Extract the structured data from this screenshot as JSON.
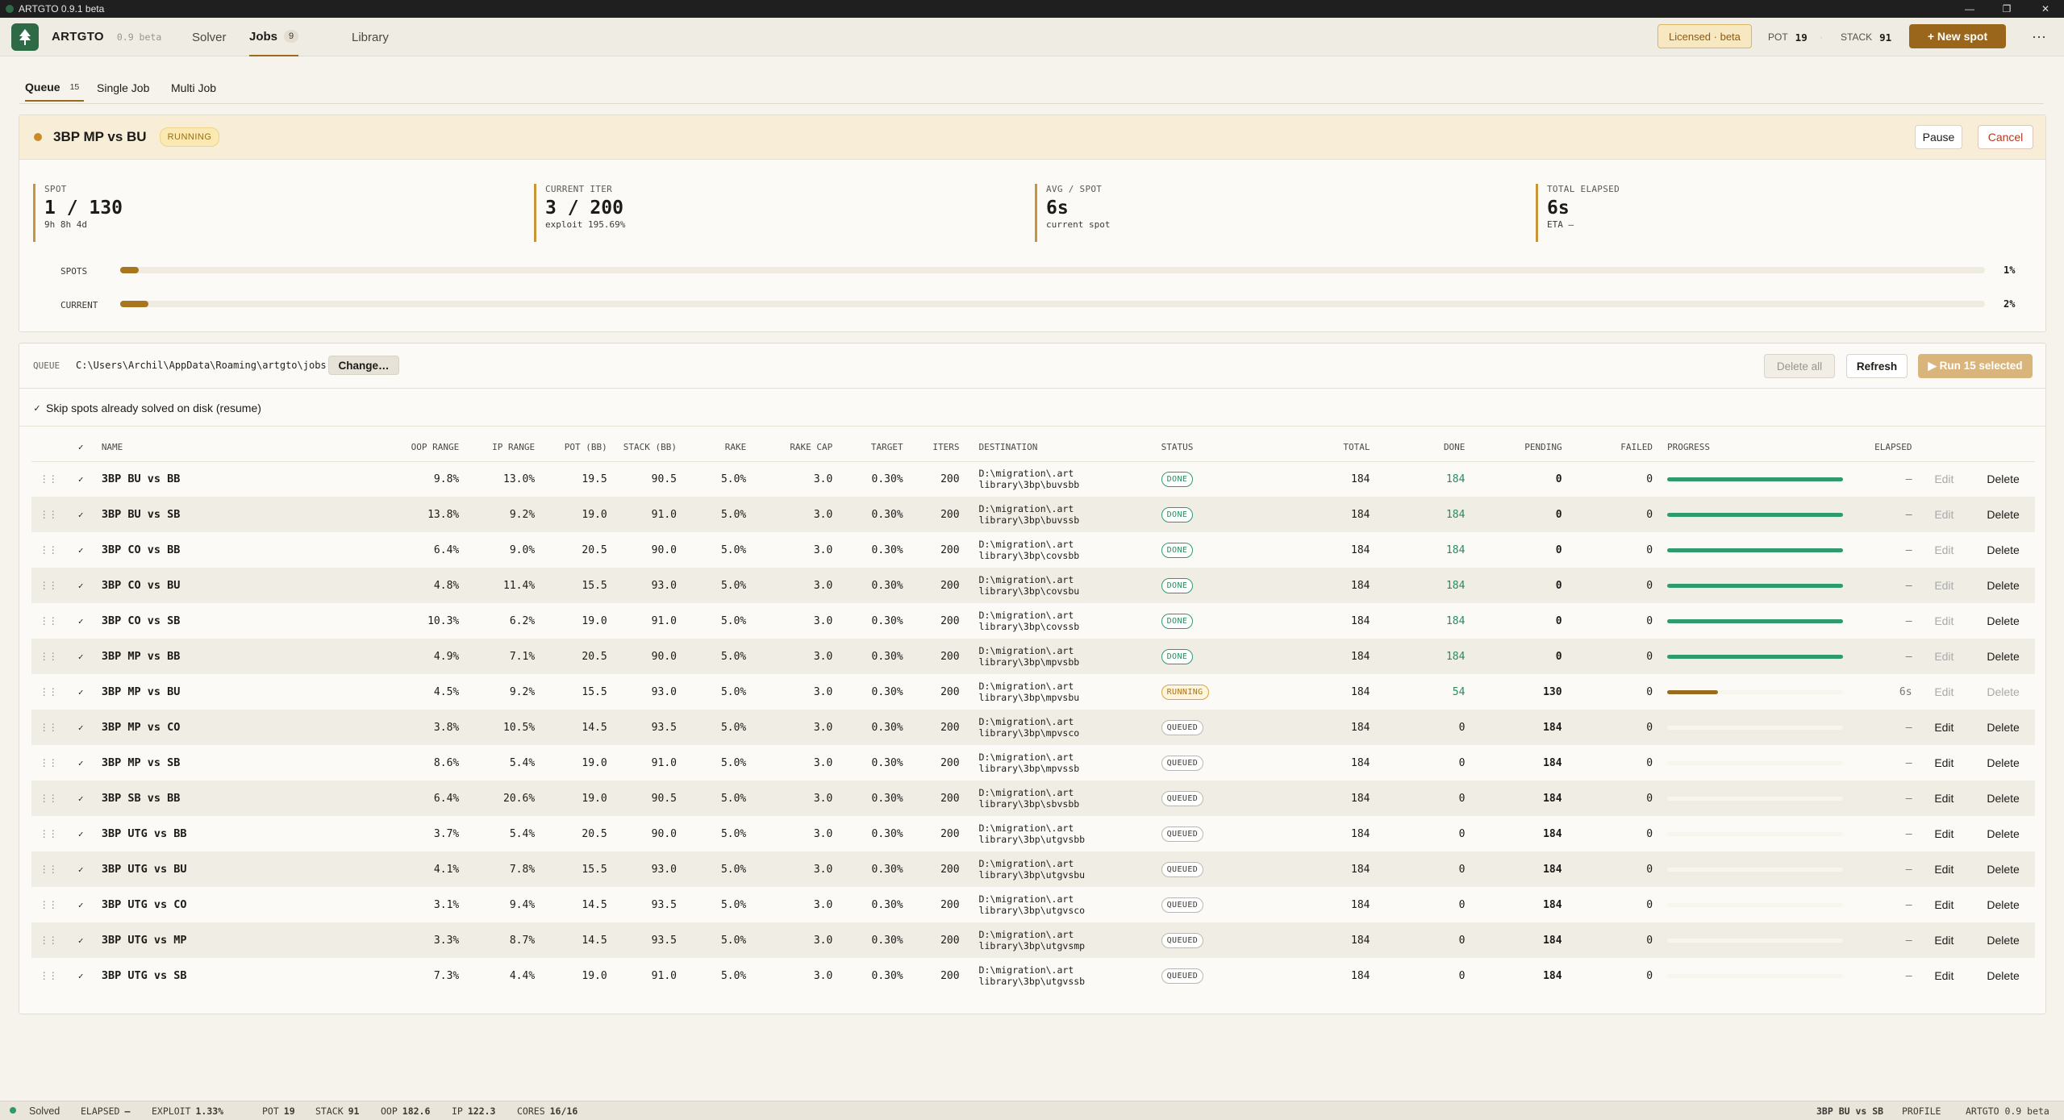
{
  "window": {
    "title": "ARTGTO 0.9.1 beta"
  },
  "header": {
    "brand": "ARTGTO",
    "version": "0.9 beta",
    "tabs": [
      {
        "label": "Solver"
      },
      {
        "label": "Jobs",
        "count": "9"
      },
      {
        "label": "Library"
      }
    ],
    "license": "Licensed · beta",
    "pot_label": "POT",
    "pot": "19",
    "stack_label": "STACK",
    "stack": "91",
    "new_spot": "+ New spot",
    "more": "···"
  },
  "subtabs": [
    {
      "label": "Queue",
      "count": "15"
    },
    {
      "label": "Single Job"
    },
    {
      "label": "Multi Job"
    }
  ],
  "running": {
    "name": "3BP MP vs BU",
    "status": "RUNNING",
    "pause": "Pause",
    "cancel": "Cancel",
    "metrics": [
      {
        "label": "SPOT",
        "value": "1 / 130",
        "sub": "9h 8h 4d"
      },
      {
        "label": "CURRENT ITER",
        "value": "3 / 200",
        "sub": "exploit 195.69%"
      },
      {
        "label": "AVG / SPOT",
        "value": "6s",
        "sub": "current spot"
      },
      {
        "label": "TOTAL ELAPSED",
        "value": "6s",
        "sub": "ETA —"
      }
    ],
    "progress": [
      {
        "label": "SPOTS",
        "pct": "1%",
        "value": 0.01
      },
      {
        "label": "CURRENT",
        "pct": "2%",
        "value": 0.015
      }
    ]
  },
  "queue": {
    "label": "QUEUE",
    "path": "C:\\Users\\Archil\\AppData\\Roaming\\artgto\\jobs",
    "change": "Change…",
    "delete_all": "Delete all",
    "refresh": "Refresh",
    "run": "▶ Run 15 selected",
    "skip": "Skip spots already solved on disk (resume)",
    "columns": [
      "NAME",
      "OOP RANGE",
      "IP RANGE",
      "POT (BB)",
      "STACK (BB)",
      "RAKE",
      "RAKE CAP",
      "TARGET",
      "ITERS",
      "DESTINATION",
      "STATUS",
      "TOTAL",
      "DONE",
      "PENDING",
      "FAILED",
      "PROGRESS",
      "ELAPSED"
    ],
    "rows": [
      {
        "name": "3BP BU vs BB",
        "oop": "9.8%",
        "ip": "13.0%",
        "pot": "19.5",
        "stack": "90.5",
        "rake": "5.0%",
        "cap": "3.0",
        "target": "0.30%",
        "iters": "200",
        "dest1": "D:\\migration\\.art",
        "dest2": "library\\3bp\\buvsbb",
        "status": "DONE",
        "total": "184",
        "done": "184",
        "pending": "0",
        "failed": "0",
        "progress": 1.0,
        "elapsed": "–",
        "edit": "Edit",
        "del": "Delete"
      },
      {
        "name": "3BP BU vs SB",
        "oop": "13.8%",
        "ip": "9.2%",
        "pot": "19.0",
        "stack": "91.0",
        "rake": "5.0%",
        "cap": "3.0",
        "target": "0.30%",
        "iters": "200",
        "dest1": "D:\\migration\\.art",
        "dest2": "library\\3bp\\buvssb",
        "status": "DONE",
        "total": "184",
        "done": "184",
        "pending": "0",
        "failed": "0",
        "progress": 1.0,
        "elapsed": "–",
        "edit": "Edit",
        "del": "Delete"
      },
      {
        "name": "3BP CO vs BB",
        "oop": "6.4%",
        "ip": "9.0%",
        "pot": "20.5",
        "stack": "90.0",
        "rake": "5.0%",
        "cap": "3.0",
        "target": "0.30%",
        "iters": "200",
        "dest1": "D:\\migration\\.art",
        "dest2": "library\\3bp\\covsbb",
        "status": "DONE",
        "total": "184",
        "done": "184",
        "pending": "0",
        "failed": "0",
        "progress": 1.0,
        "elapsed": "–",
        "edit": "Edit",
        "del": "Delete"
      },
      {
        "name": "3BP CO vs BU",
        "oop": "4.8%",
        "ip": "11.4%",
        "pot": "15.5",
        "stack": "93.0",
        "rake": "5.0%",
        "cap": "3.0",
        "target": "0.30%",
        "iters": "200",
        "dest1": "D:\\migration\\.art",
        "dest2": "library\\3bp\\covsbu",
        "status": "DONE",
        "total": "184",
        "done": "184",
        "pending": "0",
        "failed": "0",
        "progress": 1.0,
        "elapsed": "–",
        "edit": "Edit",
        "del": "Delete"
      },
      {
        "name": "3BP CO vs SB",
        "oop": "10.3%",
        "ip": "6.2%",
        "pot": "19.0",
        "stack": "91.0",
        "rake": "5.0%",
        "cap": "3.0",
        "target": "0.30%",
        "iters": "200",
        "dest1": "D:\\migration\\.art",
        "dest2": "library\\3bp\\covssb",
        "status": "DONE",
        "total": "184",
        "done": "184",
        "pending": "0",
        "failed": "0",
        "progress": 1.0,
        "elapsed": "–",
        "edit": "Edit",
        "del": "Delete"
      },
      {
        "name": "3BP MP vs BB",
        "oop": "4.9%",
        "ip": "7.1%",
        "pot": "20.5",
        "stack": "90.0",
        "rake": "5.0%",
        "cap": "3.0",
        "target": "0.30%",
        "iters": "200",
        "dest1": "D:\\migration\\.art",
        "dest2": "library\\3bp\\mpvsbb",
        "status": "DONE",
        "total": "184",
        "done": "184",
        "pending": "0",
        "failed": "0",
        "progress": 1.0,
        "elapsed": "–",
        "edit": "Edit",
        "del": "Delete"
      },
      {
        "name": "3BP MP vs BU",
        "oop": "4.5%",
        "ip": "9.2%",
        "pot": "15.5",
        "stack": "93.0",
        "rake": "5.0%",
        "cap": "3.0",
        "target": "0.30%",
        "iters": "200",
        "dest1": "D:\\migration\\.art",
        "dest2": "library\\3bp\\mpvsbu",
        "status": "RUNNING",
        "total": "184",
        "done": "54",
        "pending": "130",
        "failed": "0",
        "progress": 0.29,
        "elapsed": "6s",
        "edit": "Edit",
        "del": "Delete"
      },
      {
        "name": "3BP MP vs CO",
        "oop": "3.8%",
        "ip": "10.5%",
        "pot": "14.5",
        "stack": "93.5",
        "rake": "5.0%",
        "cap": "3.0",
        "target": "0.30%",
        "iters": "200",
        "dest1": "D:\\migration\\.art",
        "dest2": "library\\3bp\\mpvsco",
        "status": "QUEUED",
        "total": "184",
        "done": "0",
        "pending": "184",
        "failed": "0",
        "progress": 0,
        "elapsed": "–",
        "edit": "Edit",
        "del": "Delete"
      },
      {
        "name": "3BP MP vs SB",
        "oop": "8.6%",
        "ip": "5.4%",
        "pot": "19.0",
        "stack": "91.0",
        "rake": "5.0%",
        "cap": "3.0",
        "target": "0.30%",
        "iters": "200",
        "dest1": "D:\\migration\\.art",
        "dest2": "library\\3bp\\mpvssb",
        "status": "QUEUED",
        "total": "184",
        "done": "0",
        "pending": "184",
        "failed": "0",
        "progress": 0,
        "elapsed": "–",
        "edit": "Edit",
        "del": "Delete"
      },
      {
        "name": "3BP SB vs BB",
        "oop": "6.4%",
        "ip": "20.6%",
        "pot": "19.0",
        "stack": "90.5",
        "rake": "5.0%",
        "cap": "3.0",
        "target": "0.30%",
        "iters": "200",
        "dest1": "D:\\migration\\.art",
        "dest2": "library\\3bp\\sbvsbb",
        "status": "QUEUED",
        "total": "184",
        "done": "0",
        "pending": "184",
        "failed": "0",
        "progress": 0,
        "elapsed": "–",
        "edit": "Edit",
        "del": "Delete"
      },
      {
        "name": "3BP UTG vs BB",
        "oop": "3.7%",
        "ip": "5.4%",
        "pot": "20.5",
        "stack": "90.0",
        "rake": "5.0%",
        "cap": "3.0",
        "target": "0.30%",
        "iters": "200",
        "dest1": "D:\\migration\\.art",
        "dest2": "library\\3bp\\utgvsbb",
        "status": "QUEUED",
        "total": "184",
        "done": "0",
        "pending": "184",
        "failed": "0",
        "progress": 0,
        "elapsed": "–",
        "edit": "Edit",
        "del": "Delete"
      },
      {
        "name": "3BP UTG vs BU",
        "oop": "4.1%",
        "ip": "7.8%",
        "pot": "15.5",
        "stack": "93.0",
        "rake": "5.0%",
        "cap": "3.0",
        "target": "0.30%",
        "iters": "200",
        "dest1": "D:\\migration\\.art",
        "dest2": "library\\3bp\\utgvsbu",
        "status": "QUEUED",
        "total": "184",
        "done": "0",
        "pending": "184",
        "failed": "0",
        "progress": 0,
        "elapsed": "–",
        "edit": "Edit",
        "del": "Delete"
      },
      {
        "name": "3BP UTG vs CO",
        "oop": "3.1%",
        "ip": "9.4%",
        "pot": "14.5",
        "stack": "93.5",
        "rake": "5.0%",
        "cap": "3.0",
        "target": "0.30%",
        "iters": "200",
        "dest1": "D:\\migration\\.art",
        "dest2": "library\\3bp\\utgvsco",
        "status": "QUEUED",
        "total": "184",
        "done": "0",
        "pending": "184",
        "failed": "0",
        "progress": 0,
        "elapsed": "–",
        "edit": "Edit",
        "del": "Delete"
      },
      {
        "name": "3BP UTG vs MP",
        "oop": "3.3%",
        "ip": "8.7%",
        "pot": "14.5",
        "stack": "93.5",
        "rake": "5.0%",
        "cap": "3.0",
        "target": "0.30%",
        "iters": "200",
        "dest1": "D:\\migration\\.art",
        "dest2": "library\\3bp\\utgvsmp",
        "status": "QUEUED",
        "total": "184",
        "done": "0",
        "pending": "184",
        "failed": "0",
        "progress": 0,
        "elapsed": "–",
        "edit": "Edit",
        "del": "Delete"
      },
      {
        "name": "3BP UTG vs SB",
        "oop": "7.3%",
        "ip": "4.4%",
        "pot": "19.0",
        "stack": "91.0",
        "rake": "5.0%",
        "cap": "3.0",
        "target": "0.30%",
        "iters": "200",
        "dest1": "D:\\migration\\.art",
        "dest2": "library\\3bp\\utgvssb",
        "status": "QUEUED",
        "total": "184",
        "done": "0",
        "pending": "184",
        "failed": "0",
        "progress": 0,
        "elapsed": "–",
        "edit": "Edit",
        "del": "Delete"
      }
    ]
  },
  "statusbar": {
    "state": "Solved",
    "elapsed_label": "ELAPSED",
    "elapsed": "–",
    "exploit_label": "EXPLOIT",
    "exploit": "1.33%",
    "pot_label": "POT",
    "pot": "19",
    "stack_label": "STACK",
    "stack": "91",
    "oop_label": "OOP",
    "oop": "182.6",
    "ip_label": "IP",
    "ip": "122.3",
    "cores_label": "CORES",
    "cores": "16/16",
    "spot": "3BP BU vs SB",
    "profile": "PROFILE",
    "app": "ARTGTO 0.9 beta"
  },
  "colors": {
    "accent": "#99661c",
    "done": "#2f9a6b",
    "running": "#d8a53a",
    "bg": "#f5f3ec"
  }
}
